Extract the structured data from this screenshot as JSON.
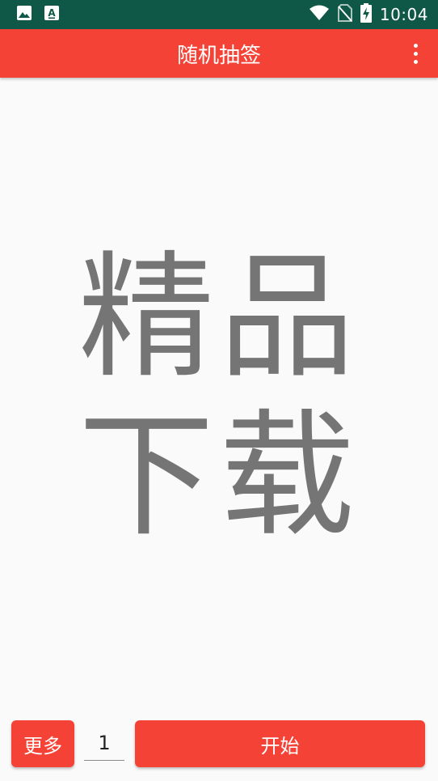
{
  "status_bar": {
    "time": "10:04",
    "icons": [
      "image-icon",
      "font-icon",
      "wifi-icon",
      "no-sim-icon",
      "battery-charging-icon"
    ]
  },
  "app_bar": {
    "title": "随机抽签",
    "overflow_icon": "more-vert-icon"
  },
  "main": {
    "result_text": "精品下载"
  },
  "bottom": {
    "more_label": "更多",
    "count_value": "1",
    "start_label": "开始"
  },
  "colors": {
    "primary": "#f44336",
    "status_bar": "#0f5747",
    "result_text": "#757575",
    "background": "#fafafa"
  }
}
